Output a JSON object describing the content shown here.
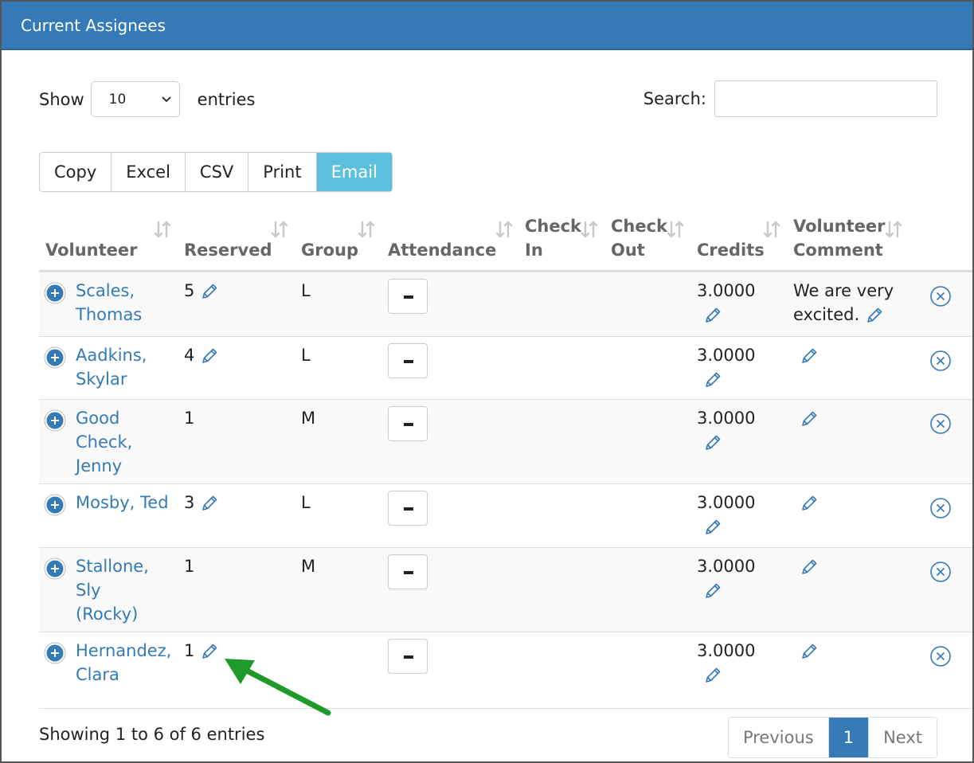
{
  "panel": {
    "title": "Current Assignees"
  },
  "length": {
    "show_label": "Show",
    "value": "10",
    "entries_label": "entries"
  },
  "search": {
    "label": "Search:",
    "value": "",
    "placeholder": ""
  },
  "export_buttons": [
    "Copy",
    "Excel",
    "CSV",
    "Print",
    "Email"
  ],
  "export_active": "Email",
  "columns": [
    "Volunteer",
    "Reserved",
    "Group",
    "Attendance",
    "Check\nIn",
    "Check\nOut",
    "Credits",
    "Volunteer\nComment"
  ],
  "rows": [
    {
      "name": "Scales,\nThomas",
      "reserved": "5",
      "reserved_editable": true,
      "group": "L",
      "credits": "3.0000",
      "comment": "We are very\nexcited."
    },
    {
      "name": "Aadkins,\nSkylar",
      "reserved": "4",
      "reserved_editable": true,
      "group": "L",
      "credits": "3.0000",
      "comment": ""
    },
    {
      "name": "Good\nCheck,\nJenny",
      "reserved": "1",
      "reserved_editable": false,
      "group": "M",
      "credits": "3.0000",
      "comment": ""
    },
    {
      "name": "Mosby, Ted",
      "reserved": "3",
      "reserved_editable": true,
      "group": "L",
      "credits": "3.0000",
      "comment": ""
    },
    {
      "name": "Stallone,\nSly\n(Rocky)",
      "reserved": "1",
      "reserved_editable": false,
      "group": "M",
      "credits": "3.0000",
      "comment": ""
    },
    {
      "name": "Hernandez,\nClara",
      "reserved": "1",
      "reserved_editable": true,
      "group": "",
      "credits": "3.0000",
      "comment": ""
    }
  ],
  "footer": {
    "info": "Showing 1 to 6 of 6 entries"
  },
  "pagination": {
    "previous": "Previous",
    "current": "1",
    "next": "Next"
  },
  "colors": {
    "header": "#337ab7",
    "active_button": "#5bc0de",
    "annotation_arrow": "#1f9a2a"
  }
}
